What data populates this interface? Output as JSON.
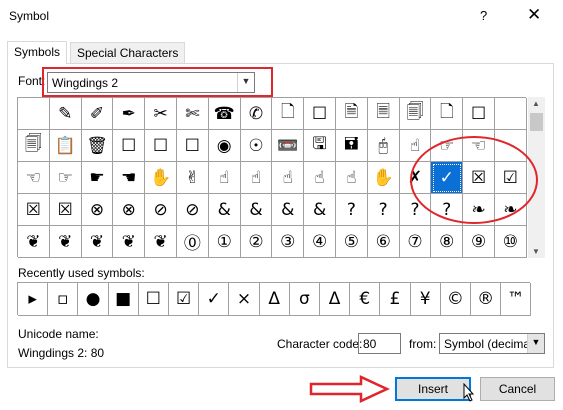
{
  "window": {
    "title": "Symbol",
    "help": "?",
    "close": "✕"
  },
  "tabs": [
    {
      "label": "Symbols",
      "active": true
    },
    {
      "label": "Special Characters",
      "active": false
    }
  ],
  "font": {
    "label": "Font:",
    "value": "Wingdings 2"
  },
  "symbol_grid": [
    [
      "",
      "✎",
      "✐",
      "✒",
      "✂",
      "✄",
      "☎",
      "✆",
      "🗋",
      "☐",
      "🗎",
      "🗏",
      "🗐",
      "🗋",
      "☐"
    ],
    [
      "🗐",
      "📋",
      "🗑",
      "☐",
      "☐",
      "☐",
      "◉",
      "☉",
      "📼",
      "🖫",
      "🖬",
      "🖰",
      "☝",
      "☞",
      "☜"
    ],
    [
      "☜",
      "☞",
      "☛",
      "☚",
      "✋",
      "✌",
      "☝",
      "☝",
      "☝",
      "☝",
      "☝",
      "✋",
      "✗",
      "✓",
      "☒",
      "☑"
    ],
    [
      "☒",
      "☒",
      "⊗",
      "⊗",
      "⊘",
      "⊘",
      "&",
      "&",
      "&",
      "&",
      "?",
      "?",
      "?",
      "?",
      "❧",
      "❧"
    ],
    [
      "❦",
      "❦",
      "❦",
      "❦",
      "❦",
      "⓪",
      "①",
      "②",
      "③",
      "④",
      "⑤",
      "⑥",
      "⑦",
      "⑧",
      "⑨",
      "⑩",
      "⓿"
    ]
  ],
  "recent_label": "Recently used symbols:",
  "recent_symbols": [
    "▸",
    "▫",
    "●",
    "■",
    "☐",
    "☑",
    "✓",
    "×",
    "Δ",
    "σ",
    "Δ",
    "€",
    "£",
    "¥",
    "©",
    "®",
    "™"
  ],
  "unicode_name_label": "Unicode name:",
  "unicode_name_value": "Wingdings 2: 80",
  "character_code_label": "Character code:",
  "character_code_value": "80",
  "from_label": "from:",
  "from_value": "Symbol (decimal)",
  "buttons": {
    "insert": "Insert",
    "cancel": "Cancel"
  },
  "colors": {
    "selection": "#0a70d6",
    "annotation": "#e0262b"
  }
}
